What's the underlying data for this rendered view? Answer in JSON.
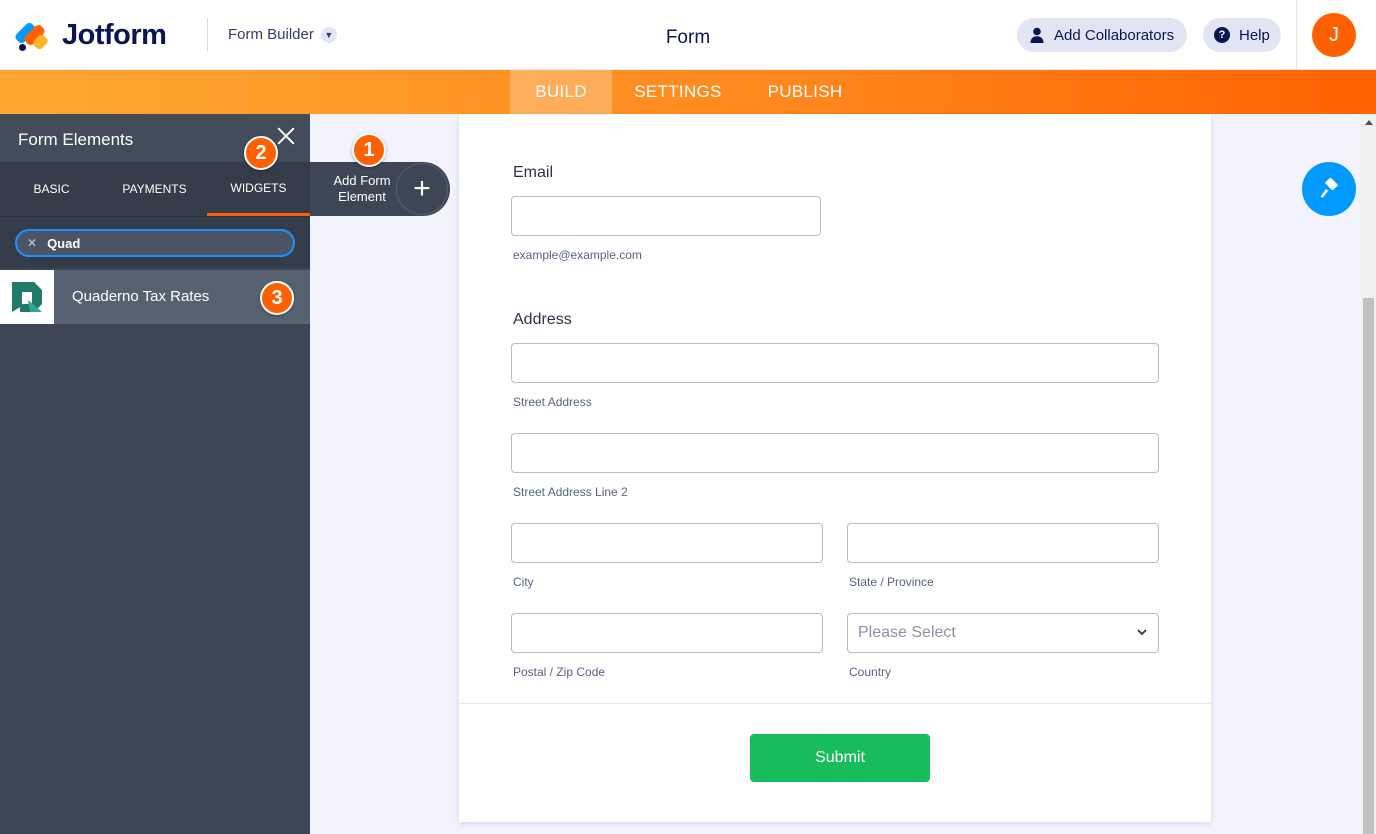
{
  "header": {
    "logo_text": "Jotform",
    "menu_label": "Form Builder",
    "page_title": "Form",
    "collaborators_label": "Add Collaborators",
    "help_label": "Help",
    "avatar_initial": "J"
  },
  "nav": {
    "tabs": [
      {
        "label": "BUILD",
        "active": true
      },
      {
        "label": "SETTINGS",
        "active": false
      },
      {
        "label": "PUBLISH",
        "active": false
      }
    ]
  },
  "sidebar": {
    "title": "Form Elements",
    "tabs": [
      {
        "label": "BASIC",
        "active": false
      },
      {
        "label": "PAYMENTS",
        "active": false
      },
      {
        "label": "WIDGETS",
        "active": true
      }
    ],
    "search_value": "Quad",
    "result_label": "Quaderno Tax Rates"
  },
  "add_element": {
    "label": "Add Form Element"
  },
  "badges": [
    "1",
    "2",
    "3"
  ],
  "form": {
    "email": {
      "label": "Email",
      "sublabel": "example@example.com"
    },
    "address": {
      "label": "Address",
      "street_sublabel": "Street Address",
      "street2_sublabel": "Street Address Line 2",
      "city_sublabel": "City",
      "state_sublabel": "State / Province",
      "postal_sublabel": "Postal / Zip Code",
      "country_sublabel": "Country",
      "country_placeholder": "Please Select"
    },
    "submit_label": "Submit"
  },
  "colors": {
    "brand_orange": "#ff6100",
    "brand_blue": "#0099ff",
    "submit_green": "#18bd5b",
    "sidebar_bg": "#3c4654"
  }
}
